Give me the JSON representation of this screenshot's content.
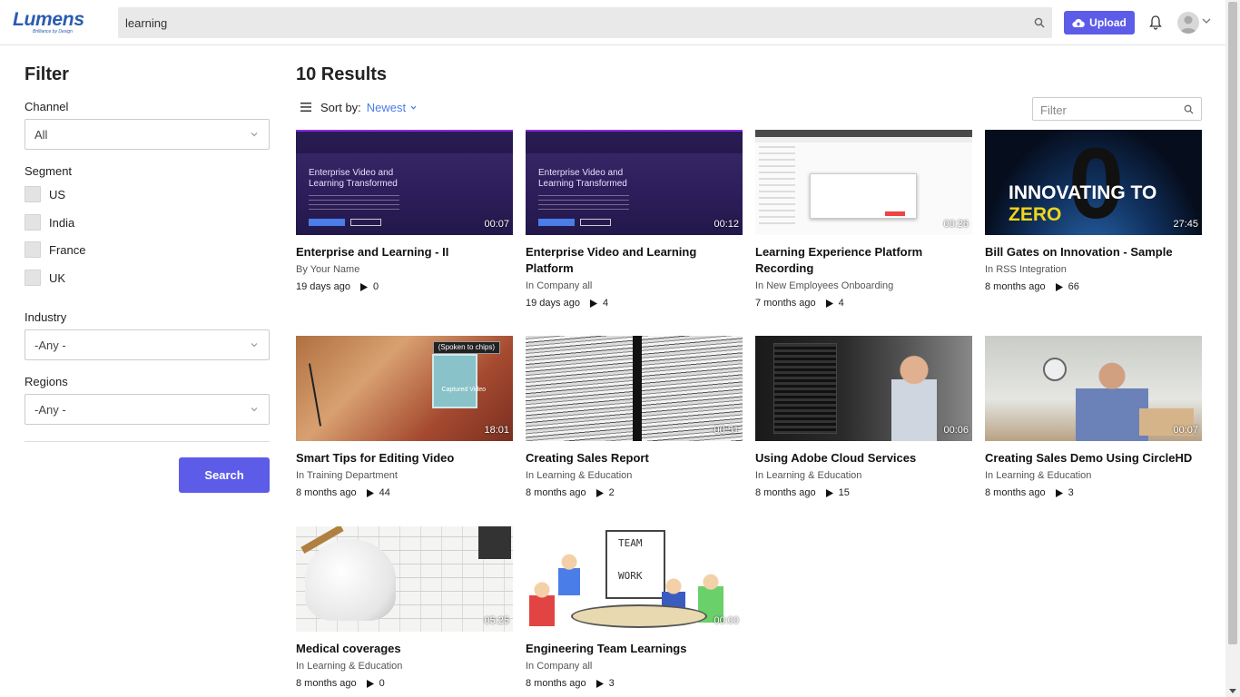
{
  "header": {
    "logo_text": "Lumens",
    "logo_tagline": "Brilliance by Design",
    "search_value": "learning",
    "upload_label": "Upload"
  },
  "filter": {
    "title": "Filter",
    "channel_label": "Channel",
    "channel_value": "All",
    "segment_label": "Segment",
    "segments": [
      "US",
      "India",
      "France",
      "UK"
    ],
    "industry_label": "Industry",
    "industry_value": "-Any -",
    "regions_label": "Regions",
    "regions_value": "-Any -",
    "search_button": "Search"
  },
  "results": {
    "title": "10 Results",
    "sort_label": "Sort by:",
    "sort_value": "Newest",
    "filter_placeholder": "Filter"
  },
  "videos": [
    {
      "title": "Enterprise and Learning - II",
      "sub": "By Your Name",
      "age": "19 days ago",
      "views": "0",
      "duration": "00:07"
    },
    {
      "title": "Enterprise Video and Learning Platform",
      "sub": "In Company all",
      "age": "19 days ago",
      "views": "4",
      "duration": "00:12"
    },
    {
      "title": "Learning Experience Platform Recording",
      "sub": "In New Employees Onboarding",
      "age": "7 months ago",
      "views": "4",
      "duration": "00:26"
    },
    {
      "title": "Bill Gates on Innovation - Sample",
      "sub": "In RSS Integration",
      "age": "8 months ago",
      "views": "66",
      "duration": "27:45"
    },
    {
      "title": "Smart Tips for Editing Video",
      "sub": "In Training Department",
      "age": "8 months ago",
      "views": "44",
      "duration": "18:01"
    },
    {
      "title": "Creating Sales Report",
      "sub": "In Learning & Education",
      "age": "8 months ago",
      "views": "2",
      "duration": "00:51"
    },
    {
      "title": "Using Adobe Cloud Services",
      "sub": "In Learning & Education",
      "age": "8 months ago",
      "views": "15",
      "duration": "00:06"
    },
    {
      "title": "Creating Sales Demo Using CircleHD",
      "sub": "In Learning & Education",
      "age": "8 months ago",
      "views": "3",
      "duration": "00:07"
    },
    {
      "title": "Medical coverages",
      "sub": "In Learning & Education",
      "age": "8 months ago",
      "views": "0",
      "duration": "05:25"
    },
    {
      "title": "Engineering Team Learnings",
      "sub": "In Company all",
      "age": "8 months ago",
      "views": "3",
      "duration": "00:00"
    }
  ],
  "thumb_text": {
    "promo_headline_1": "Enterprise Video and",
    "promo_headline_2": "Learning Transformed",
    "earth_word": "INNOVATING TO",
    "earth_accent": "ZERO",
    "chips_caption": "(Spoken to chips)",
    "captured_caption": "Captured Video",
    "team_text": "TEAM",
    "work_text": "WORK"
  },
  "colors": {
    "accent": "#5c5ce8",
    "link": "#4a7de8"
  }
}
